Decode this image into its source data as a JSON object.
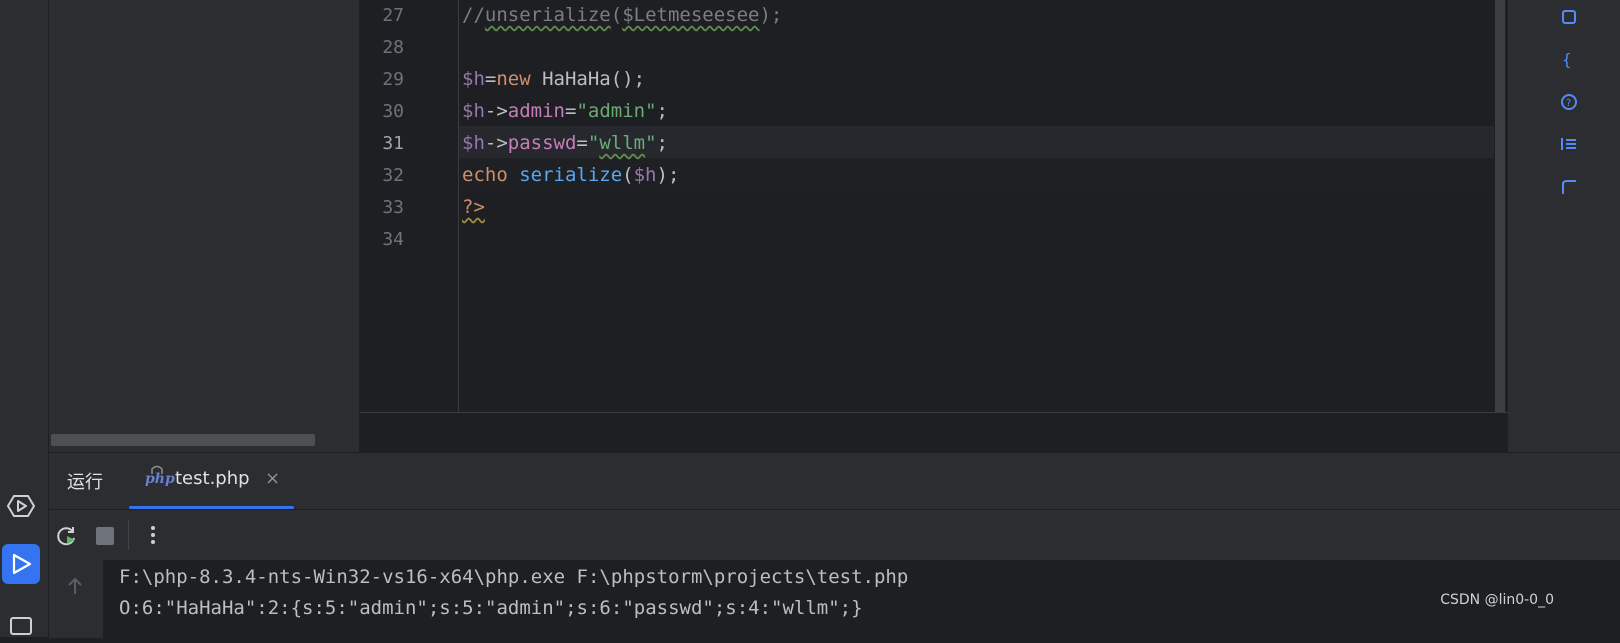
{
  "editor": {
    "lines": [
      {
        "num": "27",
        "tokens": [
          {
            "t": "//",
            "c": "tok-comment"
          },
          {
            "t": "unserialize",
            "c": "tok-comment squig"
          },
          {
            "t": "(",
            "c": "tok-comment"
          },
          {
            "t": "$Letmeseesee",
            "c": "tok-comment squig"
          },
          {
            "t": ");",
            "c": "tok-comment"
          }
        ]
      },
      {
        "num": "28",
        "tokens": []
      },
      {
        "num": "29",
        "tokens": [
          {
            "t": "$h",
            "c": "tok-dollar"
          },
          {
            "t": "=",
            "c": "tok-plain"
          },
          {
            "t": "new ",
            "c": "tok-kw"
          },
          {
            "t": "HaHaHa();",
            "c": "tok-plain"
          }
        ]
      },
      {
        "num": "30",
        "tokens": [
          {
            "t": "$h",
            "c": "tok-dollar"
          },
          {
            "t": "->",
            "c": "tok-plain"
          },
          {
            "t": "admin",
            "c": "tok-field"
          },
          {
            "t": "=",
            "c": "tok-plain"
          },
          {
            "t": "\"admin\"",
            "c": "tok-str"
          },
          {
            "t": ";",
            "c": "tok-plain"
          }
        ]
      },
      {
        "num": "31",
        "tokens": [
          {
            "t": "$h",
            "c": "tok-dollar"
          },
          {
            "t": "->",
            "c": "tok-plain"
          },
          {
            "t": "passwd",
            "c": "tok-field"
          },
          {
            "t": "=",
            "c": "tok-plain"
          },
          {
            "t": "\"",
            "c": "tok-str"
          },
          {
            "t": "wllm",
            "c": "tok-str squig"
          },
          {
            "t": "\"",
            "c": "tok-str"
          },
          {
            "t": ";",
            "c": "tok-plain"
          }
        ]
      },
      {
        "num": "32",
        "tokens": [
          {
            "t": "echo ",
            "c": "tok-kw"
          },
          {
            "t": "serialize",
            "c": "tok-fn"
          },
          {
            "t": "(",
            "c": "tok-plain"
          },
          {
            "t": "$h",
            "c": "tok-dollar"
          },
          {
            "t": ");",
            "c": "tok-plain"
          }
        ]
      },
      {
        "num": "33",
        "tokens": [
          {
            "t": "?>",
            "c": "tok-kw squig-y"
          }
        ]
      },
      {
        "num": "34",
        "tokens": []
      }
    ],
    "current_line": "31"
  },
  "run": {
    "title": "运行",
    "tab_label": "test.php",
    "tab_badge": "php",
    "tab_close": "×",
    "output": [
      "F:\\php-8.3.4-nts-Win32-vs16-x64\\php.exe F:\\phpstorm\\projects\\test.php",
      "O:6:\"HaHaHa\":2:{s:5:\"admin\";s:5:\"admin\";s:6:\"passwd\";s:4:\"wllm\";}"
    ]
  },
  "watermark": "CSDN @lin0-0_0",
  "icons": {
    "activity": [
      "services-icon",
      "run-icon",
      "terminal-icon"
    ],
    "toolbar": [
      "rerun-icon",
      "stop-icon",
      "more-options-icon"
    ],
    "console_gutter": [
      "scroll-up-icon"
    ],
    "right_strip": [
      "notifications-icon",
      "structure-icon",
      "help-icon",
      "list-icon",
      "database-icon"
    ]
  },
  "colors": {
    "accent": "#3574f0",
    "background": "#1e1f22",
    "panel": "#2b2d30"
  }
}
